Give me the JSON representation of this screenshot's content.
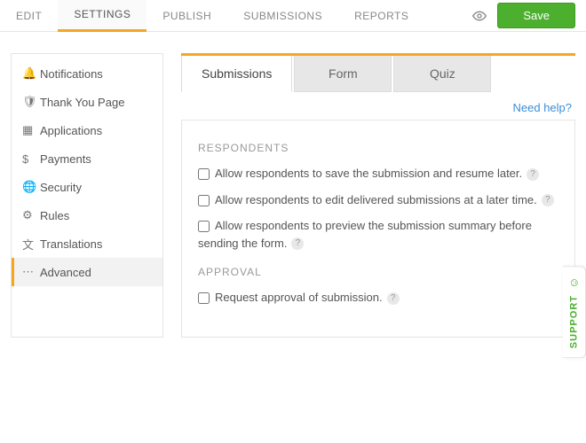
{
  "topbar": {
    "tabs": [
      {
        "label": "EDIT",
        "active": false
      },
      {
        "label": "SETTINGS",
        "active": true
      },
      {
        "label": "PUBLISH",
        "active": false
      },
      {
        "label": "SUBMISSIONS",
        "active": false
      },
      {
        "label": "REPORTS",
        "active": false
      }
    ],
    "save_label": "Save"
  },
  "sidebar": {
    "items": [
      {
        "icon": "bell-icon",
        "label": "Notifications"
      },
      {
        "icon": "shield-icon",
        "label": "Thank You Page"
      },
      {
        "icon": "apps-icon",
        "label": "Applications"
      },
      {
        "icon": "dollar-icon",
        "label": "Payments"
      },
      {
        "icon": "globe-icon",
        "label": "Security"
      },
      {
        "icon": "rules-icon",
        "label": "Rules"
      },
      {
        "icon": "translate-icon",
        "label": "Translations"
      },
      {
        "icon": "dots-icon",
        "label": "Advanced"
      }
    ],
    "active_index": 7
  },
  "subtabs": [
    {
      "label": "Submissions",
      "active": true
    },
    {
      "label": "Form",
      "active": false
    },
    {
      "label": "Quiz",
      "active": false
    }
  ],
  "help_link": "Need help?",
  "panel": {
    "sections": [
      {
        "title": "RESPONDENTS",
        "options": [
          {
            "label": "Allow respondents to save the submission and resume later.",
            "checked": false,
            "hint": true
          },
          {
            "label": "Allow respondents to edit delivered submissions at a later time.",
            "checked": false,
            "hint": true
          },
          {
            "label": "Allow respondents to preview the submission summary before sending the form.",
            "checked": false,
            "hint": true
          }
        ]
      },
      {
        "title": "APPROVAL",
        "options": [
          {
            "label": "Request approval of submission.",
            "checked": false,
            "hint": true
          }
        ]
      }
    ]
  },
  "support_label": "SUPPORT",
  "icons": {
    "bell-icon": "🔔",
    "shield-icon": "🛡",
    "apps-icon": "▦",
    "dollar-icon": "$",
    "globe-icon": "🌐",
    "rules-icon": "⚙",
    "translate-icon": "文",
    "dots-icon": "⋯",
    "eye-icon": "👁",
    "smile-icon": "☺"
  }
}
